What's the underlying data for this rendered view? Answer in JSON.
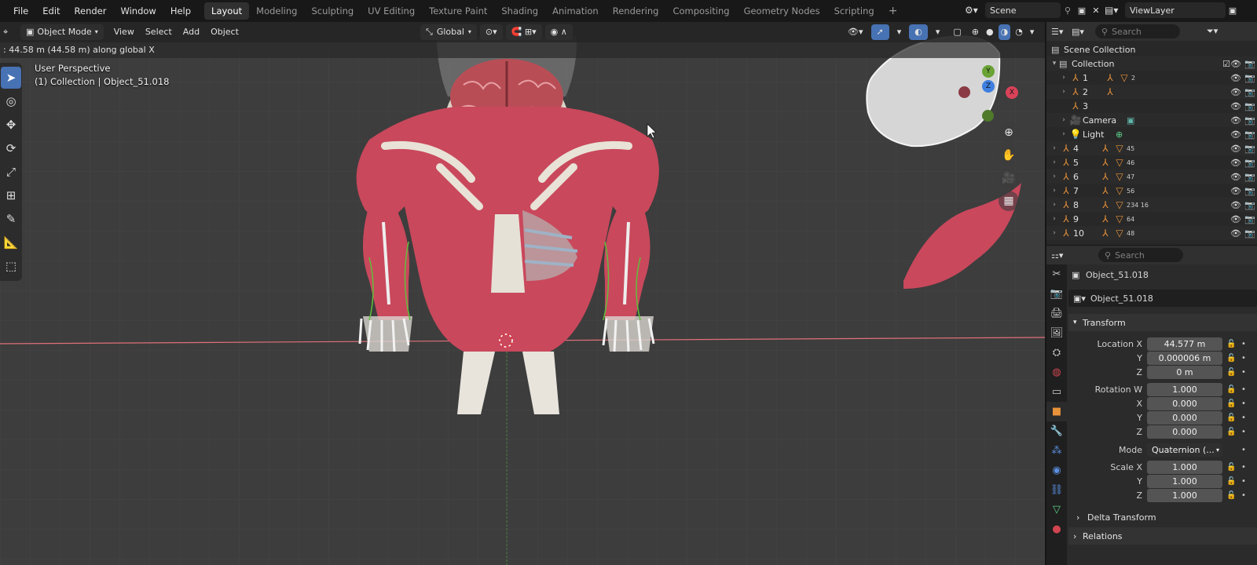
{
  "topbar": {
    "menus": [
      "File",
      "Edit",
      "Render",
      "Window",
      "Help"
    ],
    "workspaces": [
      "Layout",
      "Modeling",
      "Sculpting",
      "UV Editing",
      "Texture Paint",
      "Shading",
      "Animation",
      "Rendering",
      "Compositing",
      "Geometry Nodes",
      "Scripting"
    ],
    "active_workspace": "Layout",
    "add_tab": "+",
    "scene": "Scene",
    "view_layer": "ViewLayer"
  },
  "viewport": {
    "mode": "Object Mode",
    "menus": [
      "View",
      "Select",
      "Add",
      "Object"
    ],
    "transform_orientation": "Global",
    "status_text": ": 44.58 m (44.58 m) along global X",
    "perspective_label": "User Perspective",
    "collection_label": "(1) Collection | Object_51.018",
    "gizmo_axes": {
      "x": "X",
      "y": "Y",
      "z": "Z"
    },
    "colors": {
      "background": "#3d3d3d",
      "muscle": "#c9485c",
      "x_axis": "#e0707a",
      "accent": "#4772b3"
    }
  },
  "outliner": {
    "search_placeholder": "Search",
    "root": "Scene Collection",
    "collection": "Collection",
    "items": [
      {
        "label": "1",
        "data": "2"
      },
      {
        "label": "2",
        "data": ""
      },
      {
        "label": "3",
        "data": ""
      },
      {
        "label": "Camera",
        "data": ""
      },
      {
        "label": "Light",
        "data": ""
      },
      {
        "label": "4",
        "data": "45"
      },
      {
        "label": "5",
        "data": "46"
      },
      {
        "label": "6",
        "data": "47"
      },
      {
        "label": "7",
        "data": "56"
      },
      {
        "label": "8",
        "data": "234 16"
      },
      {
        "label": "9",
        "data": "64"
      },
      {
        "label": "10",
        "data": "48"
      }
    ]
  },
  "properties": {
    "search_placeholder": "Search",
    "object_name": "Object_51.018",
    "datablock_name": "Object_51.018",
    "transform_title": "Transform",
    "location": {
      "label": "Location X",
      "x": "44.577 m",
      "y_label": "Y",
      "y": "0.000006 m",
      "z_label": "Z",
      "z": "0 m"
    },
    "rotation": {
      "label": "Rotation W",
      "w": "1.000",
      "x_label": "X",
      "x": "0.000",
      "y_label": "Y",
      "y": "0.000",
      "z_label": "Z",
      "z": "0.000"
    },
    "mode": {
      "label": "Mode",
      "value": "Quaternion (..."
    },
    "scale": {
      "label": "Scale X",
      "x": "1.000",
      "y_label": "Y",
      "y": "1.000",
      "z_label": "Z",
      "z": "1.000"
    },
    "delta_transform": "Delta Transform",
    "relations": "Relations"
  }
}
